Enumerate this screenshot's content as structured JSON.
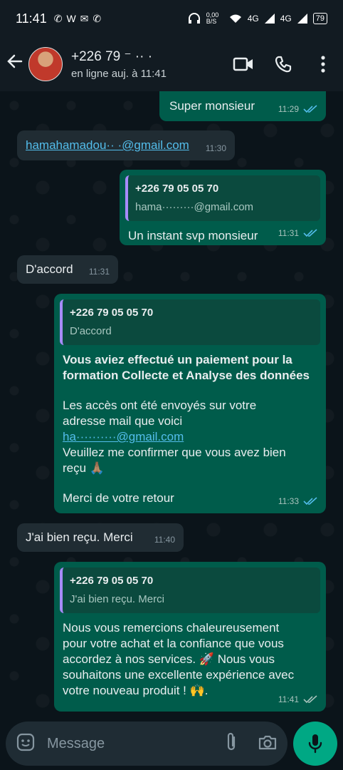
{
  "status_bar": {
    "time": "11:41",
    "app_icons": [
      "✆",
      "W",
      "✉",
      "✆"
    ],
    "net_speed": "0,00 B/S",
    "network_1": "4G",
    "network_2": "4G",
    "battery": "79"
  },
  "header": {
    "contact_name": "+226 79 ⁻ ·· ·",
    "contact_status": "en ligne auj. à 11:41"
  },
  "messages": [
    {
      "text": "Super monsieur",
      "time": "11:29"
    },
    {
      "email": "hamahamadou·· ·@gmail.com",
      "time": "11:30"
    },
    {
      "quote_name": "+226 79 05 05 70",
      "quote_text": "hama·········@gmail.com",
      "text": "Un instant svp monsieur",
      "time": "11:31"
    },
    {
      "text": "D'accord",
      "time": "11:31"
    },
    {
      "quote_name": "+226 79 05 05 70",
      "quote_text": "D'accord",
      "bold_line1": "Vous aviez effectué un paiement pour la",
      "bold_line2": "formation Collecte et Analyse des données",
      "line1": "Les accès ont été envoyés sur votre",
      "line2": "adresse mail que voici",
      "email": "ha··········@gmail.com",
      "line3": "Veuillez me confirmer que vous avez bien",
      "line4": "reçu 🙏🏽",
      "line5": "Merci de votre retour",
      "time": "11:33"
    },
    {
      "text": "J'ai bien reçu. Merci",
      "time": "11:40"
    },
    {
      "quote_name": "+226 79 05 05 70",
      "quote_text": "J'ai bien reçu. Merci",
      "line1": "Nous vous remercions chaleureusement",
      "line2": "pour votre achat et la confiance que vous",
      "line3": "accordez à nos services. 🚀 Nous vous",
      "line4": "souhaitons une excellente expérience avec",
      "line5": "votre nouveau produit ! 🙌.",
      "time": "11:41"
    }
  ],
  "composer": {
    "placeholder": "Message"
  },
  "colors": {
    "outgoing": "#005c4b",
    "incoming": "#202c33",
    "accent": "#00a884",
    "read_ticks": "#53bdeb"
  }
}
